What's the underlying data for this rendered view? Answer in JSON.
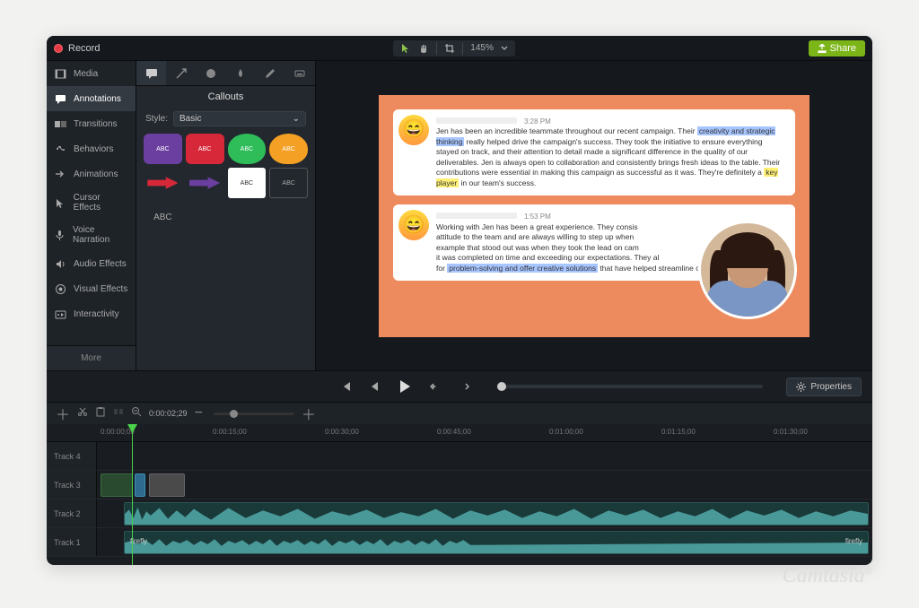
{
  "topbar": {
    "record_label": "Record",
    "zoom_pct": "145%",
    "share_label": "Share"
  },
  "sidebar": {
    "items": [
      {
        "label": "Media"
      },
      {
        "label": "Annotations"
      },
      {
        "label": "Transitions"
      },
      {
        "label": "Behaviors"
      },
      {
        "label": "Animations"
      },
      {
        "label": "Cursor Effects"
      },
      {
        "label": "Voice Narration"
      },
      {
        "label": "Audio Effects"
      },
      {
        "label": "Visual Effects"
      },
      {
        "label": "Interactivity"
      }
    ],
    "more_label": "More"
  },
  "panel": {
    "title": "Callouts",
    "style_label": "Style:",
    "style_value": "Basic",
    "swatch_text": "ABC"
  },
  "preview": {
    "msg1_time": "3:28 PM",
    "msg1_text_a": "Jen has been an incredible teammate throughout our recent campaign. Their ",
    "msg1_hl1": "creativity and strategic thinking",
    "msg1_text_b": " really helped drive the campaign's success. They took the initiative to ensure everything stayed on track, and their attention to detail made a significant difference in the quality of our deliverables. Jen is always open to collaboration and consistently brings fresh ideas to the table. Their contributions were essential in making this campaign as successful as it was. They're definitely a ",
    "msg1_hl2": "key player",
    "msg1_text_c": " in our team's success.",
    "msg2_time": "1:53 PM",
    "msg2_text_a": "Working with Jen has been a great experience. They consis",
    "msg2_text_b": "attitude to the team and are always willing to step up when",
    "msg2_text_c": "example that stood out was when they took the lead on cam",
    "msg2_text_d": "it was completed on time and exceeding our expectations. They al",
    "msg2_text_e": "for ",
    "msg2_hl1": "problem-solving and offer creative solutions",
    "msg2_text_f": " that have helped streamline our"
  },
  "controls": {
    "properties_label": "Properties"
  },
  "timeline": {
    "timecode": "0:00:02;29",
    "ruler": [
      "0:00:00;00",
      "0:00:15;00",
      "0:00:30;00",
      "0:00:45;00",
      "0:01:00;00",
      "0:01:15;00",
      "0:01:30;00"
    ],
    "tracks": [
      "Track 4",
      "Track 3",
      "Track 2",
      "Track 1"
    ],
    "clip_label_t1_left": "firefly",
    "clip_label_t1_right": "firefly"
  },
  "watermark": "Camtasia",
  "watermark_r": "®"
}
